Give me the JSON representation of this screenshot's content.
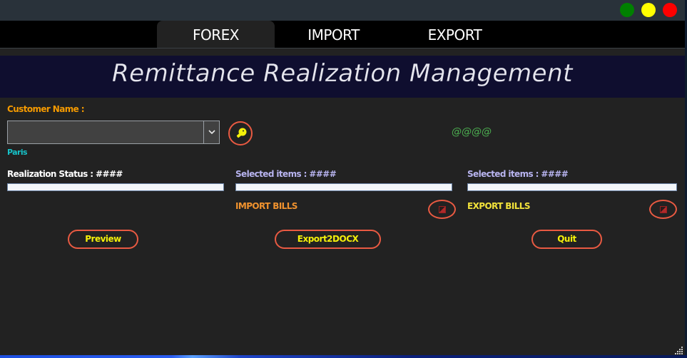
{
  "window_controls": [
    {
      "name": "minimize",
      "color": "#008000"
    },
    {
      "name": "maximize",
      "color": "#ffff00"
    },
    {
      "name": "close",
      "color": "#ff0000"
    }
  ],
  "tabs": [
    {
      "label": "FOREX",
      "active": true
    },
    {
      "label": "IMPORT",
      "active": false
    },
    {
      "label": "EXPORT",
      "active": false
    }
  ],
  "banner": {
    "title": "Remittance Realization Management"
  },
  "customer": {
    "label": "Customer Name :",
    "combo_value": "",
    "subtext": "Paris",
    "search_icon": "key-icon"
  },
  "status_text": "@@@@",
  "realization": {
    "label": "Realization Status : ####",
    "progress": 0
  },
  "import": {
    "selected_label": "Selected items : ####",
    "progress": 0,
    "bills_label": "IMPORT BILLS",
    "toggle_icon": "select-all-icon"
  },
  "export": {
    "selected_label": "Selected items : ####",
    "progress": 0,
    "bills_label": "EXPORT BILLS",
    "toggle_icon": "select-all-icon"
  },
  "buttons": {
    "preview": "Preview",
    "export_docx": "Export2DOCX",
    "quit": "Quit"
  },
  "colors": {
    "orange_label": "#f59a00",
    "cyan_label": "#16c2c8",
    "green_status": "#4caf50",
    "purple_label": "#b8b4f0",
    "import_label": "#f0922e",
    "export_label": "#f2e23a",
    "button_text": "#f4f00a",
    "accent_border": "#e95a42"
  }
}
